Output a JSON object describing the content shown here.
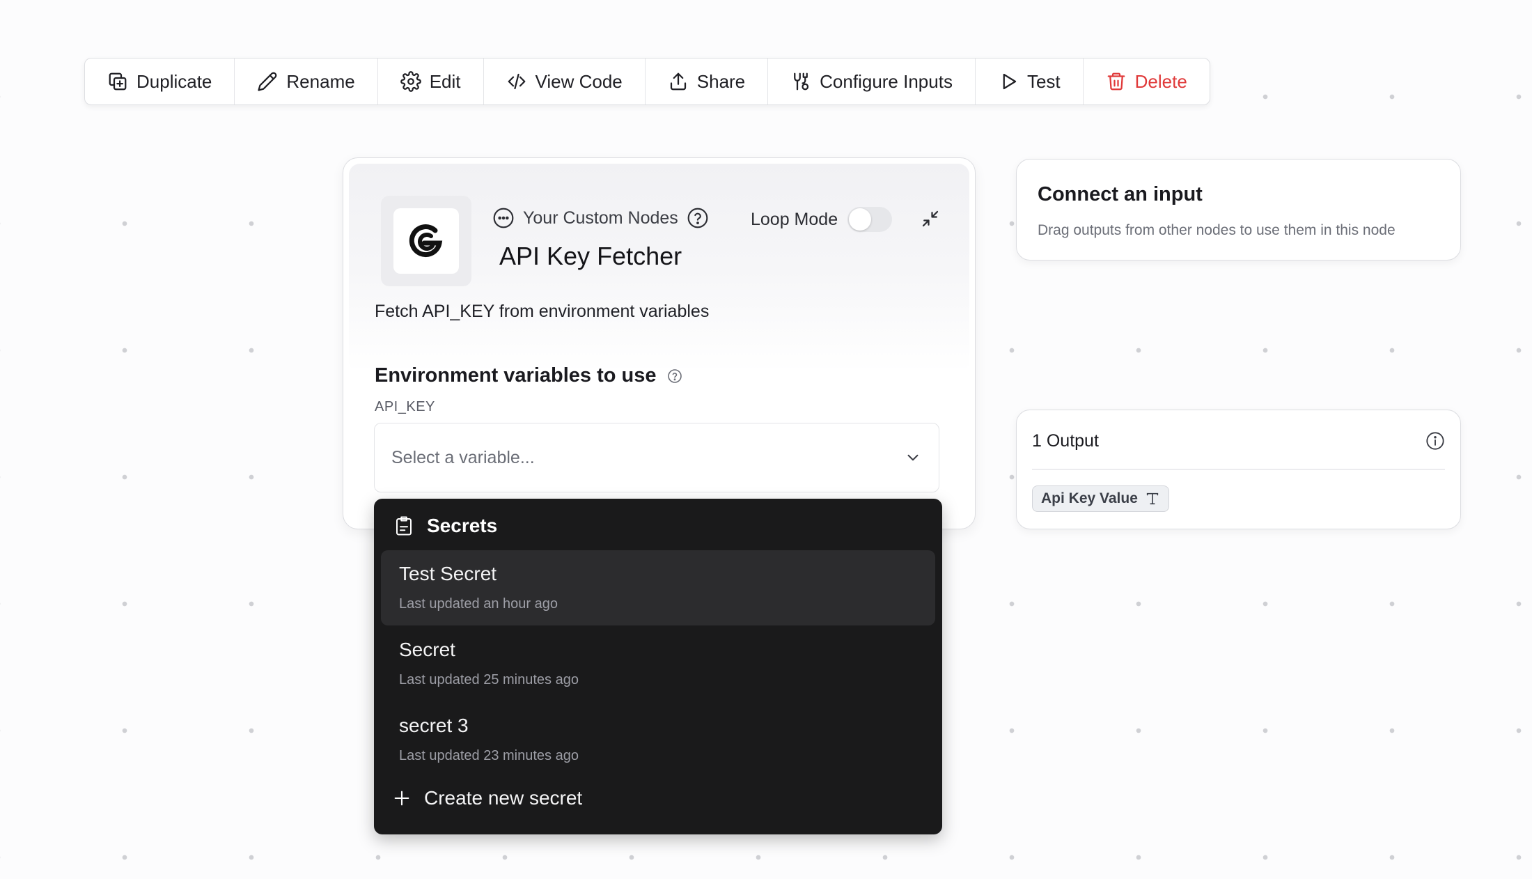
{
  "toolbar": {
    "buttons": [
      {
        "label": "Duplicate",
        "icon": "duplicate-icon"
      },
      {
        "label": "Rename",
        "icon": "pencil-icon"
      },
      {
        "label": "Edit",
        "icon": "gear-icon"
      },
      {
        "label": "View Code",
        "icon": "code-icon"
      },
      {
        "label": "Share",
        "icon": "share-icon"
      },
      {
        "label": "Configure Inputs",
        "icon": "configure-icon"
      },
      {
        "label": "Test",
        "icon": "play-icon"
      },
      {
        "label": "Delete",
        "icon": "trash-icon"
      }
    ],
    "danger_color": "#e03a3a"
  },
  "node": {
    "breadcrumb": "Your Custom Nodes",
    "loop_mode_label": "Loop Mode",
    "loop_mode_on": false,
    "title": "API Key Fetcher",
    "description": "Fetch API_KEY from environment variables",
    "env_section_title": "Environment variables to use",
    "env_key": "API_KEY",
    "select_placeholder": "Select a variable..."
  },
  "dropdown": {
    "header": "Secrets",
    "items": [
      {
        "name": "Test Secret",
        "meta": "Last updated an hour ago"
      },
      {
        "name": "Secret",
        "meta": "Last updated 25 minutes ago"
      },
      {
        "name": "secret 3",
        "meta": "Last updated 23 minutes ago"
      }
    ],
    "create_label": "Create new secret"
  },
  "connect": {
    "title": "Connect an input",
    "subtitle": "Drag outputs from other nodes to use them in this node"
  },
  "output": {
    "title": "1 Output",
    "chip_label": "Api Key Value"
  }
}
